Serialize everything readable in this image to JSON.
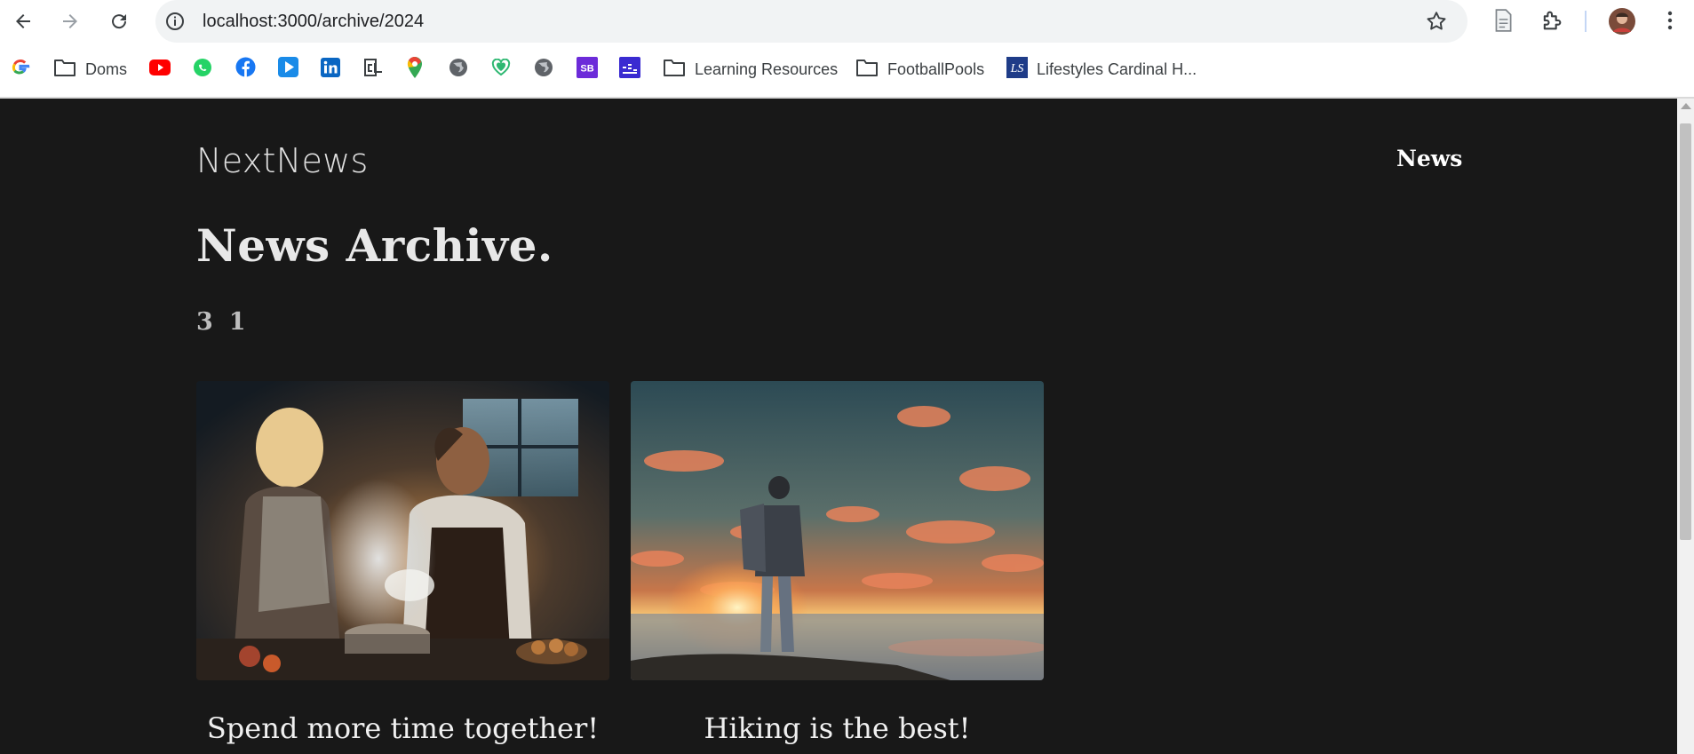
{
  "browser": {
    "url": "localhost:3000/archive/2024",
    "icons": [
      "back-arrow-icon",
      "forward-arrow-icon",
      "reload-icon",
      "site-info-icon",
      "bookmark-star-icon",
      "document-icon",
      "extensions-icon",
      "profile-avatar",
      "kebab-menu-icon"
    ]
  },
  "bookmarks": [
    {
      "label": "",
      "icon": "google-icon"
    },
    {
      "label": "Doms",
      "icon": "folder-icon"
    },
    {
      "label": "",
      "icon": "youtube-icon"
    },
    {
      "label": "",
      "icon": "whatsapp-icon"
    },
    {
      "label": "",
      "icon": "facebook-icon"
    },
    {
      "label": "",
      "icon": "play-icon"
    },
    {
      "label": "",
      "icon": "linkedin-icon"
    },
    {
      "label": "",
      "icon": "cl-icon"
    },
    {
      "label": "",
      "icon": "maps-pin-icon"
    },
    {
      "label": "",
      "icon": "globe-icon"
    },
    {
      "label": "",
      "icon": "heart-shield-icon"
    },
    {
      "label": "",
      "icon": "globe-icon"
    },
    {
      "label": "",
      "icon": "sb-icon"
    },
    {
      "label": "",
      "icon": "bars-icon"
    },
    {
      "label": "Learning Resources",
      "icon": "folder-icon"
    },
    {
      "label": "FootballPools",
      "icon": "folder-icon"
    },
    {
      "label": "Lifestyles Cardinal H...",
      "icon": "ls-icon"
    }
  ],
  "site": {
    "logo": "NextNews",
    "nav": {
      "news_label": "News"
    }
  },
  "archive": {
    "title": "News Archive.",
    "months": [
      "3",
      "1"
    ]
  },
  "news": [
    {
      "title": "Spend more time together!",
      "image": "couple-cooking-image"
    },
    {
      "title": "Hiking is the best!",
      "image": "hiker-sunset-image"
    }
  ],
  "colors": {
    "page_bg": "#181818",
    "text": "#e8e8e8",
    "muted": "#bdbdbd"
  }
}
